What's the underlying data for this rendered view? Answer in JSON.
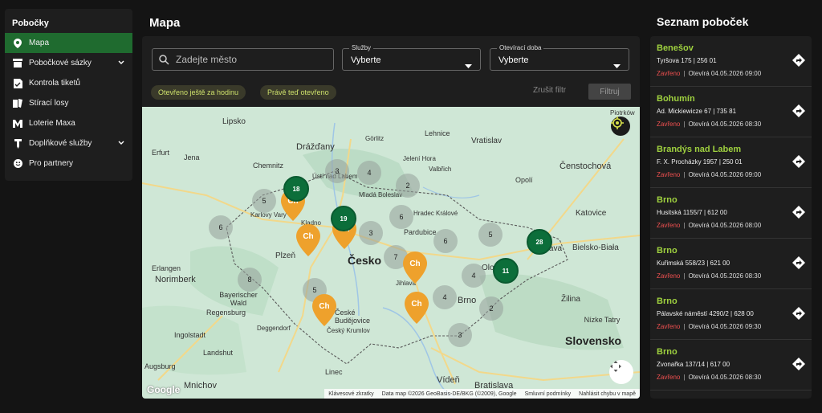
{
  "sidebar": {
    "title": "Pobočky",
    "items": [
      {
        "label": "Mapa",
        "icon": "map-pin-icon",
        "active": true
      },
      {
        "label": "Pobočkové sázky",
        "icon": "store-icon",
        "expandable": true
      },
      {
        "label": "Kontrola tiketů",
        "icon": "ticket-check-icon"
      },
      {
        "label": "Stírací losy",
        "icon": "scratch-card-icon"
      },
      {
        "label": "Loterie Maxa",
        "icon": "maxa-logo-icon"
      },
      {
        "label": "Doplňkové služby",
        "icon": "services-icon",
        "expandable": true
      },
      {
        "label": "Pro partnery",
        "icon": "smile-icon"
      }
    ]
  },
  "main": {
    "title": "Mapa",
    "search": {
      "placeholder": "Zadejte město",
      "value": ""
    },
    "services_select": {
      "label": "Služby",
      "value": "Vyberte"
    },
    "hours_select": {
      "label": "Otevírací doba",
      "value": "Vyberte"
    },
    "chips": [
      "Otevřeno ještě za hodinu",
      "Právě teď otevřeno"
    ],
    "clear_filter": "Zrušit filtr",
    "filter_button": "Filtruj"
  },
  "map": {
    "labels": [
      {
        "text": "Lipsko"
      },
      {
        "text": "Drážďany"
      },
      {
        "text": "Görlitz"
      },
      {
        "text": "Lehnice"
      },
      {
        "text": "Vratislav"
      },
      {
        "text": "Erfurt"
      },
      {
        "text": "Jena"
      },
      {
        "text": "Chemnitz"
      },
      {
        "text": "Ústí nad Labem"
      },
      {
        "text": "Jelení Hora"
      },
      {
        "text": "Valbřich"
      },
      {
        "text": "Čenstochová"
      },
      {
        "text": "Opolí"
      },
      {
        "text": "Mladá Boleslav"
      },
      {
        "text": "Hradec Králové"
      },
      {
        "text": "Karlovy Vary"
      },
      {
        "text": "Kladno"
      },
      {
        "text": "Pardubice"
      },
      {
        "text": "Katovice"
      },
      {
        "text": "Plzeň"
      },
      {
        "text": "Česko"
      },
      {
        "text": "Bielsko-Biała"
      },
      {
        "text": "Erlangen"
      },
      {
        "text": "Norimberk"
      },
      {
        "text": "Ostrava"
      },
      {
        "text": "Olomouc"
      },
      {
        "text": "Jihlava"
      },
      {
        "text": "Bayerischer Wald"
      },
      {
        "text": "Brno"
      },
      {
        "text": "Žilina"
      },
      {
        "text": "České Budějovice"
      },
      {
        "text": "Regensburg"
      },
      {
        "text": "Ingolstadt"
      },
      {
        "text": "Deggendorf"
      },
      {
        "text": "Český Krumlov"
      },
      {
        "text": "Nízke Tatry"
      },
      {
        "text": "Slovensko"
      },
      {
        "text": "Landshut"
      },
      {
        "text": "Linec"
      },
      {
        "text": "Augsburg"
      },
      {
        "text": "Mnichov"
      },
      {
        "text": "Vídeň"
      },
      {
        "text": "Bratislava"
      },
      {
        "text": "Piotrków"
      }
    ],
    "clusters_grey": [
      "3",
      "4",
      "2",
      "5",
      "6",
      "6",
      "3",
      "6",
      "5",
      "7",
      "8",
      "5",
      "4",
      "4",
      "2",
      "3"
    ],
    "clusters_green": [
      "18",
      "19",
      "28",
      "11"
    ],
    "pin_label": "Ch",
    "attribution": [
      "Klávesové zkratky",
      "Data map ©2026 GeoBasis-DE/BKG (©2009), Google",
      "Smluvní podmínky",
      "Nahlásit chybu v mapě"
    ],
    "google_logo": "Google"
  },
  "list": {
    "title": "Seznam poboček",
    "closed_label": "Zavřeno",
    "branches": [
      {
        "name": "Benešov",
        "address": "Tyršova 175 | 256 01",
        "opens": "Otevírá 04.05.2026 09:00"
      },
      {
        "name": "Bohumín",
        "address": "Ad. Mickiewicze 67 | 735 81",
        "opens": "Otevírá 04.05.2026 08:30"
      },
      {
        "name": "Brandýs nad Labem",
        "address": "F. X. Procházky 1957 | 250 01",
        "opens": "Otevírá 04.05.2026 09:00"
      },
      {
        "name": "Brno",
        "address": "Husitská 1155/7 | 612 00",
        "opens": "Otevírá 04.05.2026 08:00"
      },
      {
        "name": "Brno",
        "address": "Kuřimská 558/23 | 621 00",
        "opens": "Otevírá 04.05.2026 08:30"
      },
      {
        "name": "Brno",
        "address": "Pálavské náměstí 4290/2 | 628 00",
        "opens": "Otevírá 04.05.2026 09:30"
      },
      {
        "name": "Brno",
        "address": "Zvonařka 137/14 | 617 00",
        "opens": "Otevírá 04.05.2026 08:30"
      }
    ]
  },
  "colors": {
    "accent_green": "#9fd13f",
    "active_nav": "#1f6b2f",
    "closed_red": "#f05050",
    "pin_orange": "#eea12c",
    "cluster_green": "#0c6e3a"
  }
}
